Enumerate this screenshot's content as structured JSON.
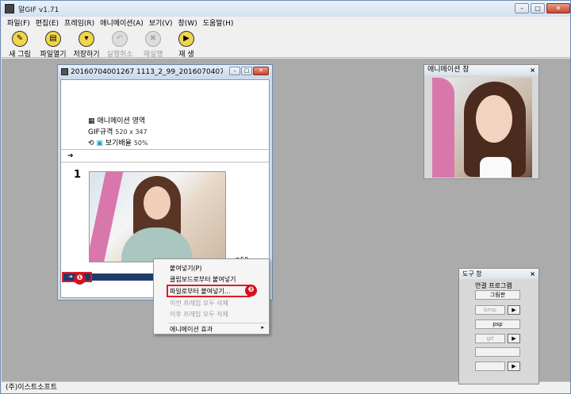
{
  "app": {
    "title": "알GIF v1.71"
  },
  "window_buttons": {
    "minimize": "–",
    "restore": "□",
    "close": "✕"
  },
  "menu": [
    "파일(F)",
    "편집(E)",
    "프레임(R)",
    "애니메이션(A)",
    "보기(V)",
    "창(W)",
    "도움말(H)"
  ],
  "toolbar": [
    {
      "label": "새 그림",
      "icon": "new-image-icon",
      "glyph": "✎",
      "enabled": true
    },
    {
      "label": "파일열기",
      "icon": "open-file-icon",
      "glyph": "▤",
      "enabled": true
    },
    {
      "label": "저장하기",
      "icon": "save-icon",
      "glyph": "▾",
      "enabled": true
    },
    {
      "label": "실행취소",
      "icon": "undo-icon",
      "glyph": "↶",
      "enabled": false
    },
    {
      "label": "재실행",
      "icon": "redo-icon",
      "glyph": "✖",
      "enabled": false
    },
    {
      "label": "재 생",
      "icon": "play-icon",
      "glyph": "▶",
      "enabled": true
    }
  ],
  "doc_window": {
    "title": "20160704001267 1113_2_99_20160704074207.j...",
    "animation_area_label": "애니메이션 영역",
    "gif_spec_label": "GIF규격",
    "gif_spec_value": "520 x 347",
    "zoom_label": "보기배율",
    "zoom_value": "50%",
    "arrow": "➔",
    "frame_number": "1",
    "frame_delay": "50",
    "frame_bar_arrow": "➔"
  },
  "context_menu": {
    "items": [
      {
        "label": "붙여넣기(P)",
        "enabled": true
      },
      {
        "label": "클립보드로부터 붙여넣기",
        "enabled": true
      },
      {
        "label": "파일로부터 붙여넣기...",
        "enabled": true,
        "highlighted": true
      },
      {
        "label": "이전 프레임 모두 삭제",
        "enabled": false
      },
      {
        "label": "이후 프레임 모두 삭제",
        "enabled": false
      },
      {
        "label": "애니메이션 효과",
        "enabled": true,
        "submenu": true
      }
    ],
    "submenu_arrow": "▸"
  },
  "annotations": {
    "badge_1": "❶",
    "badge_2": "❷",
    "color": "#d1121d"
  },
  "animation_window": {
    "title": "애니메이션 창",
    "close": "×"
  },
  "tool_window": {
    "title": "도구 창",
    "close": "×",
    "caption": "연결 프로그램",
    "buttons": [
      {
        "label": "그림판",
        "enabled": true,
        "has_arrow": false
      },
      {
        "label": "bmp",
        "enabled": false,
        "has_arrow": true
      },
      {
        "label": "psp",
        "enabled": true,
        "has_arrow": false
      },
      {
        "label": "gif",
        "enabled": false,
        "has_arrow": true
      },
      {
        "label": "",
        "enabled": true,
        "has_arrow": false
      },
      {
        "label": "",
        "enabled": false,
        "has_arrow": true
      }
    ],
    "arrow_glyph": "▶"
  },
  "status": {
    "text": "(주)이스트소프트"
  }
}
